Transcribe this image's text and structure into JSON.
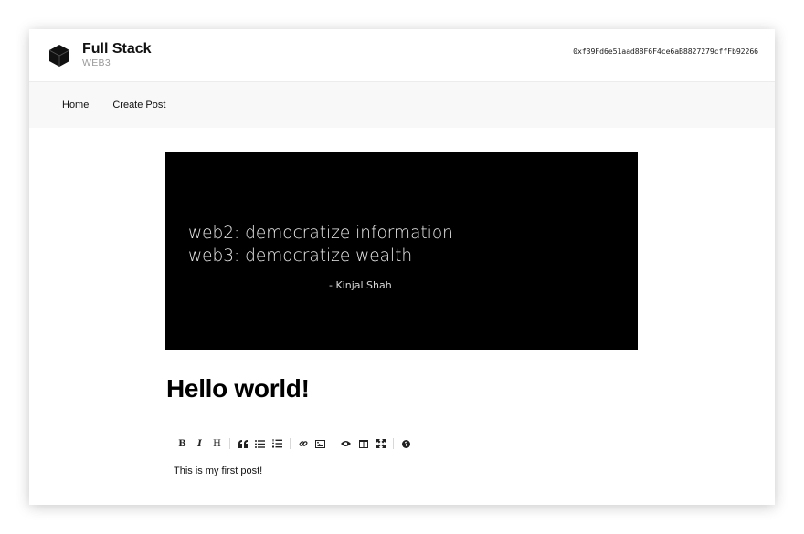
{
  "header": {
    "brand_title": "Full Stack",
    "brand_subtitle": "WEB3",
    "account_address": "0xf39Fd6e51aad88F6F4ce6aB8827279cffFb92266"
  },
  "nav": {
    "items": [
      {
        "label": "Home"
      },
      {
        "label": "Create Post"
      }
    ]
  },
  "post": {
    "cover": {
      "line1": "web2: democratize information",
      "line2": "web3: democratize wealth",
      "attribution": "- Kinjal Shah"
    },
    "title": "Hello world!",
    "body": "This is my first post!"
  },
  "editor": {
    "toolbar": {
      "bold_label": "B",
      "italic_label": "I",
      "heading_label": "H"
    }
  },
  "colors": {
    "cover_background": "#000000",
    "nav_background": "#f8f8f8",
    "brand_subtitle": "#9a9a9a"
  }
}
